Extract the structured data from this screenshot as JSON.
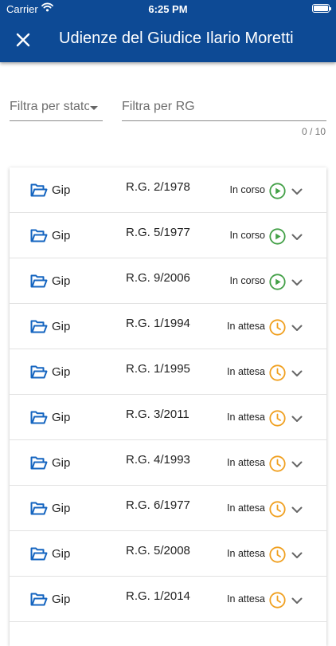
{
  "status_bar": {
    "carrier": "Carrier",
    "time": "6:25 PM"
  },
  "header": {
    "title": "Udienze del Giudice Ilario Moretti"
  },
  "filters": {
    "state_label": "Filtra per stato",
    "rg_placeholder": "Filtra per RG",
    "counter": "0 / 10"
  },
  "colors": {
    "appbar": "#0d4a95",
    "in_corso": "#43a047",
    "in_attesa": "#f0a020",
    "folder": "#1565c0"
  },
  "hearings": [
    {
      "type": "Gip",
      "rg": "R.G. 2/1978",
      "status": "In corso",
      "icon": "play-circle-icon"
    },
    {
      "type": "Gip",
      "rg": "R.G. 5/1977",
      "status": "In corso",
      "icon": "play-circle-icon"
    },
    {
      "type": "Gip",
      "rg": "R.G. 9/2006",
      "status": "In corso",
      "icon": "play-circle-icon"
    },
    {
      "type": "Gip",
      "rg": "R.G. 1/1994",
      "status": "In attesa",
      "icon": "clock-icon"
    },
    {
      "type": "Gip",
      "rg": "R.G. 1/1995",
      "status": "In attesa",
      "icon": "clock-icon"
    },
    {
      "type": "Gip",
      "rg": "R.G. 3/2011",
      "status": "In attesa",
      "icon": "clock-icon"
    },
    {
      "type": "Gip",
      "rg": "R.G. 4/1993",
      "status": "In attesa",
      "icon": "clock-icon"
    },
    {
      "type": "Gip",
      "rg": "R.G. 6/1977",
      "status": "In attesa",
      "icon": "clock-icon"
    },
    {
      "type": "Gip",
      "rg": "R.G. 5/2008",
      "status": "In attesa",
      "icon": "clock-icon"
    },
    {
      "type": "Gip",
      "rg": "R.G. 1/2014",
      "status": "In attesa",
      "icon": "clock-icon"
    }
  ]
}
